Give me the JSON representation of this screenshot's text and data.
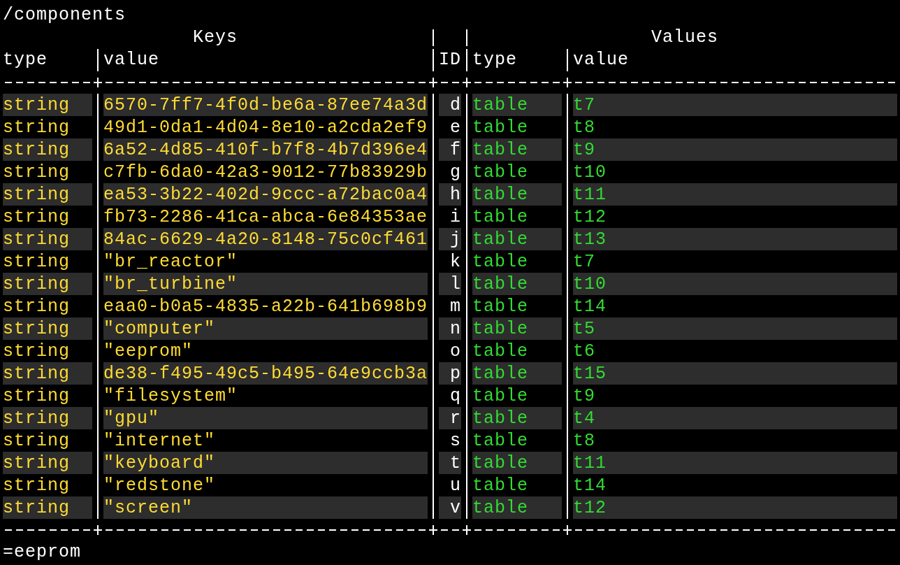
{
  "path": "/components",
  "groups": [
    {
      "label": "Keys"
    },
    {
      "label": "Values"
    }
  ],
  "columns": {
    "key_type": "type",
    "key_value": "value",
    "id": "ID",
    "value_type": "type",
    "value_value": "value"
  },
  "rows": [
    {
      "key_type": "string",
      "key_value": "6570-7ff7-4f0d-be6a-87ee74a3d",
      "id": "d",
      "value_type": "table",
      "value": "t7",
      "shaded": true
    },
    {
      "key_type": "string",
      "key_value": "49d1-0da1-4d04-8e10-a2cda2ef9",
      "id": "e",
      "value_type": "table",
      "value": "t8",
      "shaded": false
    },
    {
      "key_type": "string",
      "key_value": "6a52-4d85-410f-b7f8-4b7d396e4",
      "id": "f",
      "value_type": "table",
      "value": "t9",
      "shaded": true
    },
    {
      "key_type": "string",
      "key_value": "c7fb-6da0-42a3-9012-77b83929b",
      "id": "g",
      "value_type": "table",
      "value": "t10",
      "shaded": false
    },
    {
      "key_type": "string",
      "key_value": "ea53-3b22-402d-9ccc-a72bac0a4",
      "id": "h",
      "value_type": "table",
      "value": "t11",
      "shaded": true
    },
    {
      "key_type": "string",
      "key_value": "fb73-2286-41ca-abca-6e84353ae",
      "id": "i",
      "value_type": "table",
      "value": "t12",
      "shaded": false
    },
    {
      "key_type": "string",
      "key_value": "84ac-6629-4a20-8148-75c0cf461",
      "id": "j",
      "value_type": "table",
      "value": "t13",
      "shaded": true
    },
    {
      "key_type": "string",
      "key_value": "\"br_reactor\"",
      "id": "k",
      "value_type": "table",
      "value": "t7",
      "shaded": false
    },
    {
      "key_type": "string",
      "key_value": "\"br_turbine\"",
      "id": "l",
      "value_type": "table",
      "value": "t10",
      "shaded": true
    },
    {
      "key_type": "string",
      "key_value": "eaa0-b0a5-4835-a22b-641b698b9",
      "id": "m",
      "value_type": "table",
      "value": "t14",
      "shaded": false
    },
    {
      "key_type": "string",
      "key_value": "\"computer\"",
      "id": "n",
      "value_type": "table",
      "value": "t5",
      "shaded": true
    },
    {
      "key_type": "string",
      "key_value": "\"eeprom\"",
      "id": "o",
      "value_type": "table",
      "value": "t6",
      "shaded": false
    },
    {
      "key_type": "string",
      "key_value": "de38-f495-49c5-b495-64e9ccb3a",
      "id": "p",
      "value_type": "table",
      "value": "t15",
      "shaded": true
    },
    {
      "key_type": "string",
      "key_value": "\"filesystem\"",
      "id": "q",
      "value_type": "table",
      "value": "t9",
      "shaded": false
    },
    {
      "key_type": "string",
      "key_value": "\"gpu\"",
      "id": "r",
      "value_type": "table",
      "value": "t4",
      "shaded": true
    },
    {
      "key_type": "string",
      "key_value": "\"internet\"",
      "id": "s",
      "value_type": "table",
      "value": "t8",
      "shaded": false
    },
    {
      "key_type": "string",
      "key_value": "\"keyboard\"",
      "id": "t",
      "value_type": "table",
      "value": "t11",
      "shaded": true
    },
    {
      "key_type": "string",
      "key_value": "\"redstone\"",
      "id": "u",
      "value_type": "table",
      "value": "t14",
      "shaded": false
    },
    {
      "key_type": "string",
      "key_value": "\"screen\"",
      "id": "v",
      "value_type": "table",
      "value": "t12",
      "shaded": true
    }
  ],
  "prompt": "=eeprom"
}
